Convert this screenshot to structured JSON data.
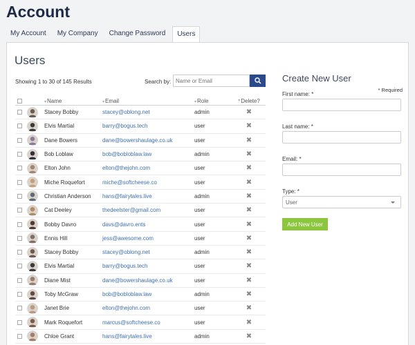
{
  "page_title": "Account",
  "tabs": [
    {
      "label": "My Account"
    },
    {
      "label": "My Company"
    },
    {
      "label": "Change Password"
    },
    {
      "label": "Users",
      "active": true
    }
  ],
  "users_panel": {
    "heading": "Users",
    "showing_text": "Showing 1 to 30 of 145 Results",
    "search_label": "Search by:",
    "search_placeholder": "Name or Email",
    "search_icon": "search-icon",
    "columns": {
      "name": "Name",
      "email": "Email",
      "role": "Role",
      "delete": "Delete?"
    },
    "rows": [
      {
        "name": "Stacey Bobby",
        "email": "stacey@oblong.net",
        "role": "admin"
      },
      {
        "name": "Elvis Martial",
        "email": "barry@bogus.tech",
        "role": "user"
      },
      {
        "name": "Dane Bowers",
        "email": "dane@bowershaulage.co.uk",
        "role": "user"
      },
      {
        "name": "Bob Loblaw",
        "email": "bob@bobloblaw.law",
        "role": "admin"
      },
      {
        "name": "Elton John",
        "email": "elton@thejohn.com",
        "role": "user"
      },
      {
        "name": "Miche Roquefort",
        "email": "miche@softcheese.co",
        "role": "user"
      },
      {
        "name": "Christian Anderson",
        "email": "hans@fairytales.live",
        "role": "admin"
      },
      {
        "name": "Cat Deeley",
        "email": "thedeelster@gmail.com",
        "role": "user"
      },
      {
        "name": "Bobby Davro",
        "email": "davs@davro.ents",
        "role": "user"
      },
      {
        "name": "Ennis Hill",
        "email": "jess@awesome.com",
        "role": "user"
      },
      {
        "name": "Stacey Bobby",
        "email": "stacey@oblong.net",
        "role": "admin"
      },
      {
        "name": "Elvis Martial",
        "email": "barry@bogus.tech",
        "role": "user"
      },
      {
        "name": "Diane Mist",
        "email": "dane@bowershaulage.co.uk",
        "role": "user"
      },
      {
        "name": "Toby McGraw",
        "email": "bob@bobloblaw.law",
        "role": "admin"
      },
      {
        "name": "Janet Brie",
        "email": "elton@thejohn.com",
        "role": "user"
      },
      {
        "name": "Mark Roquefort",
        "email": "marcus@softcheese.co",
        "role": "user"
      },
      {
        "name": "Chloe Grant",
        "email": "hans@fairytales.live",
        "role": "admin"
      }
    ]
  },
  "create_form": {
    "title": "Create New User",
    "required_note": "* Required",
    "first_name_label": "First name: *",
    "last_name_label": "Last name: *",
    "email_label": "Email: *",
    "type_label": "Type: *",
    "type_value": "User",
    "submit_label": "Add New User"
  },
  "colors": {
    "accent_blue": "#2b4a8b",
    "link_blue": "#3f6fb0",
    "button_green": "#8cc63f",
    "title_navy": "#1d2b46"
  },
  "avatar_palette": [
    "#6b5a4e",
    "#3a3a3a",
    "#8a7a9c",
    "#2f2f36",
    "#a0866f",
    "#c7a07a",
    "#5a6b7a",
    "#b08b64",
    "#4b3b33",
    "#7e6e64",
    "#6b5a4e",
    "#3a3a3a",
    "#9a7a6a",
    "#5e4b42",
    "#b99a80",
    "#7a5c4a",
    "#a57a66"
  ]
}
